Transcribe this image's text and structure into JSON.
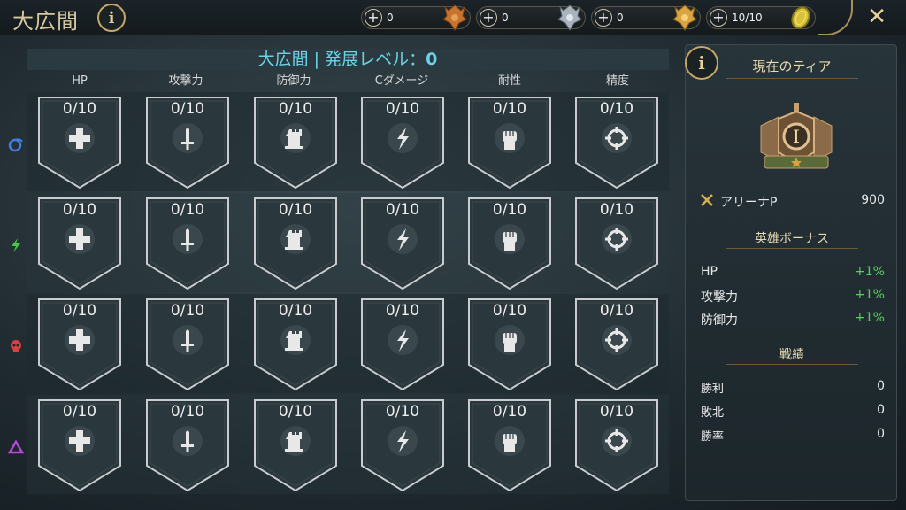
{
  "header": {
    "title": "大広間",
    "close_label": "✕",
    "resources": [
      {
        "value": "0",
        "icon": "bronze-emblem-icon",
        "color": "#c8742e"
      },
      {
        "value": "0",
        "icon": "silver-emblem-icon",
        "color": "#a9b4be"
      },
      {
        "value": "0",
        "icon": "gold-emblem-icon",
        "color": "#d9a441"
      },
      {
        "value": "10/10",
        "icon": "gold-coin-icon",
        "color": "#d8c23a"
      }
    ]
  },
  "grid": {
    "title_prefix": "大広間 | 発展レベル：",
    "level": "0",
    "columns": [
      "HP",
      "攻撃力",
      "防御力",
      "Cダメージ",
      "耐性",
      "精度"
    ],
    "column_icons": [
      "cross-icon",
      "sword-icon",
      "tower-icon",
      "lightning-icon",
      "fist-icon",
      "crosshair-icon"
    ],
    "rows": [
      {
        "affinity": "magic",
        "icon": "magic-swirl-icon",
        "color": "#3f7fe0",
        "cells": [
          "0/10",
          "0/10",
          "0/10",
          "0/10",
          "0/10",
          "0/10"
        ]
      },
      {
        "affinity": "force",
        "icon": "lightning-icon",
        "color": "#49c44a",
        "cells": [
          "0/10",
          "0/10",
          "0/10",
          "0/10",
          "0/10",
          "0/10"
        ]
      },
      {
        "affinity": "spirit",
        "icon": "skull-icon",
        "color": "#d6403f",
        "cells": [
          "0/10",
          "0/10",
          "0/10",
          "0/10",
          "0/10",
          "0/10"
        ]
      },
      {
        "affinity": "void",
        "icon": "triangle-icon",
        "color": "#b44ad6",
        "cells": [
          "0/10",
          "0/10",
          "0/10",
          "0/10",
          "0/10",
          "0/10"
        ]
      }
    ]
  },
  "panel": {
    "current_tier_label": "現在のティア",
    "tier_numeral": "I",
    "arena_label": "アリーナP",
    "arena_value": "900",
    "hero_bonus_label": "英雄ボーナス",
    "bonuses": [
      {
        "label": "HP",
        "value": "+1%"
      },
      {
        "label": "攻撃力",
        "value": "+1%"
      },
      {
        "label": "防御力",
        "value": "+1%"
      }
    ],
    "record_label": "戦績",
    "records": [
      {
        "label": "勝利",
        "value": "0"
      },
      {
        "label": "敗北",
        "value": "0"
      },
      {
        "label": "勝率",
        "value": "0"
      }
    ]
  }
}
